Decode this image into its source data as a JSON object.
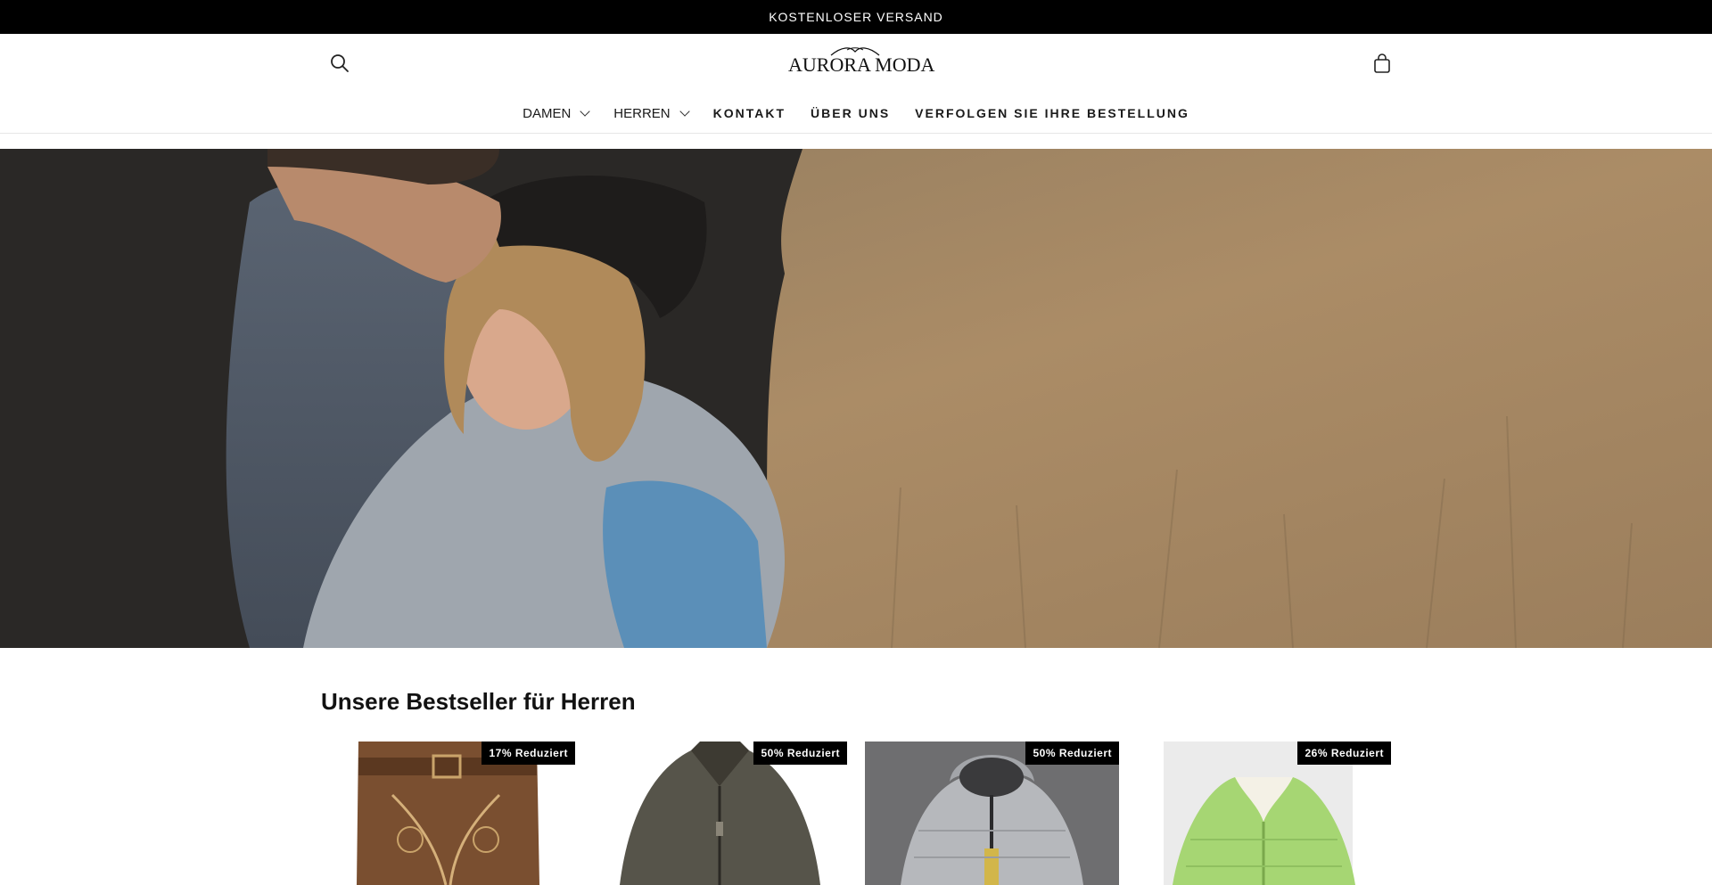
{
  "announcement": {
    "text": "KOSTENLOSER VERSAND"
  },
  "header": {
    "logo_text": "AURORA MODA",
    "icons": {
      "search": "search-icon",
      "cart": "cart-icon"
    }
  },
  "nav": {
    "items": [
      {
        "label": "DAMEN",
        "has_dropdown": true
      },
      {
        "label": "HERREN",
        "has_dropdown": true
      },
      {
        "label": "KONTAKT",
        "has_dropdown": false
      },
      {
        "label": "ÜBER UNS",
        "has_dropdown": false
      },
      {
        "label": "VERFOLGEN SIE IHRE BESTELLUNG",
        "has_dropdown": false
      }
    ]
  },
  "section": {
    "title": "Unsere Bestseller für Herren"
  },
  "products": [
    {
      "badge": "17% Reduziert"
    },
    {
      "badge": "50% Reduziert"
    },
    {
      "badge": "50% Reduziert"
    },
    {
      "badge": "26% Reduziert"
    }
  ],
  "colors": {
    "announcement_bg": "#000000",
    "badge_bg": "#000000",
    "text": "#121212"
  }
}
